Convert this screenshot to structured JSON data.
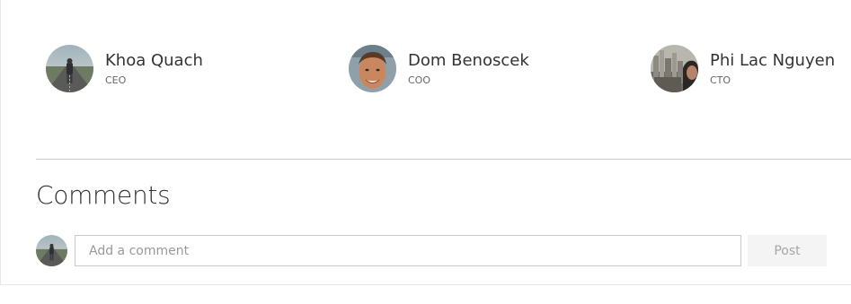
{
  "people": [
    {
      "name": "Khoa Quach",
      "role": "CEO",
      "avatar_icon": "road-photo-avatar"
    },
    {
      "name": "Dom Benoscek",
      "role": "COO",
      "avatar_icon": "face-photo-avatar"
    },
    {
      "name": "Phi Lac Nguyen",
      "role": "CTO",
      "avatar_icon": "city-photo-avatar"
    }
  ],
  "comments": {
    "title": "Comments",
    "input_placeholder": "Add a comment",
    "input_value": "",
    "post_label": "Post"
  },
  "colors": {
    "text_primary": "#333333",
    "text_secondary": "#666666",
    "divider": "#c8c8c8",
    "post_button_bg": "#f4f4f4",
    "post_button_text": "#a6a6a6"
  }
}
